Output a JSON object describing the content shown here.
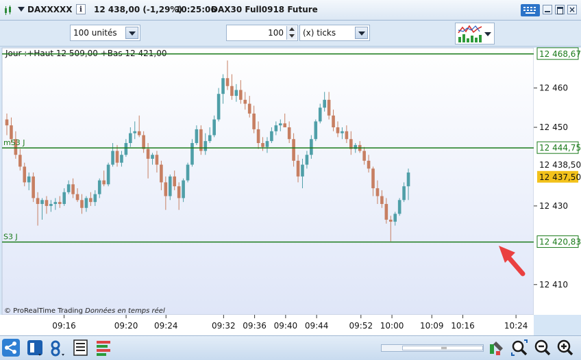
{
  "title_bar": {
    "instrument": "DAXXXXX",
    "info_label": "i",
    "price_change": "12 438,00 (-1,29%)",
    "time": "10:25:06",
    "contract": "DAX30 Full0918 Future"
  },
  "toolbar": {
    "units_value": "100 unités",
    "tick_count": "100",
    "period_type": "(x) ticks"
  },
  "chart_data": {
    "type": "candlestick",
    "title": "Jour :+Haut 12 509,00 +Bas 12 421,00",
    "ylim": [
      12402.3,
      12470.2
    ],
    "y_ticks": [
      12410,
      12430,
      12450,
      12460
    ],
    "y_tick_labels": [
      "12 410",
      "12 430",
      "12 450",
      "12 460"
    ],
    "x_tick_labels": [
      "09:16",
      "09:20",
      "09:24",
      "09:32",
      "09:36",
      "09:40",
      "09:44",
      "09:52",
      "10:00",
      "10:09",
      "10:16",
      "10:24"
    ],
    "levels": [
      {
        "name": "",
        "value": 12468.67,
        "label": "12 468,67",
        "color": "#1a7a1a"
      },
      {
        "name": "mS3 J",
        "value": 12444.75,
        "label": "12 444,75",
        "color": "#1a7a1a"
      },
      {
        "name": "S3 J",
        "value": 12420.83,
        "label": "12 420,83",
        "color": "#1a7a1a"
      }
    ],
    "last_price_label": "12 438,50",
    "current_price": {
      "value": 12437.5,
      "label": "12 437,50",
      "color": "#f3c21b"
    },
    "candles": [
      {
        "o": 12452.0,
        "h": 12453.5,
        "l": 12448.0,
        "c": 12450.5
      },
      {
        "o": 12450.5,
        "h": 12452.5,
        "l": 12446.0,
        "c": 12447.0
      },
      {
        "o": 12447.0,
        "h": 12449.0,
        "l": 12442.0,
        "c": 12443.0
      },
      {
        "o": 12443.0,
        "h": 12444.5,
        "l": 12439.0,
        "c": 12440.0
      },
      {
        "o": 12440.0,
        "h": 12441.0,
        "l": 12435.0,
        "c": 12436.0
      },
      {
        "o": 12436.0,
        "h": 12438.5,
        "l": 12434.0,
        "c": 12437.5
      },
      {
        "o": 12437.5,
        "h": 12438.5,
        "l": 12431.0,
        "c": 12432.0
      },
      {
        "o": 12432.0,
        "h": 12433.5,
        "l": 12425.0,
        "c": 12430.5
      },
      {
        "o": 12430.5,
        "h": 12432.0,
        "l": 12426.5,
        "c": 12431.5
      },
      {
        "o": 12431.5,
        "h": 12432.5,
        "l": 12428.0,
        "c": 12430.0
      },
      {
        "o": 12430.0,
        "h": 12431.5,
        "l": 12428.5,
        "c": 12430.5
      },
      {
        "o": 12430.5,
        "h": 12432.0,
        "l": 12429.0,
        "c": 12431.0
      },
      {
        "o": 12431.0,
        "h": 12432.5,
        "l": 12429.5,
        "c": 12430.5
      },
      {
        "o": 12430.5,
        "h": 12434.5,
        "l": 12430.0,
        "c": 12433.5
      },
      {
        "o": 12433.5,
        "h": 12436.5,
        "l": 12433.0,
        "c": 12435.5
      },
      {
        "o": 12435.5,
        "h": 12437.0,
        "l": 12432.0,
        "c": 12433.0
      },
      {
        "o": 12433.0,
        "h": 12434.5,
        "l": 12431.0,
        "c": 12431.5
      },
      {
        "o": 12431.5,
        "h": 12433.0,
        "l": 12428.0,
        "c": 12429.5
      },
      {
        "o": 12429.5,
        "h": 12432.5,
        "l": 12428.5,
        "c": 12432.0
      },
      {
        "o": 12432.0,
        "h": 12433.5,
        "l": 12430.0,
        "c": 12431.0
      },
      {
        "o": 12431.0,
        "h": 12434.0,
        "l": 12430.0,
        "c": 12433.0
      },
      {
        "o": 12433.0,
        "h": 12437.0,
        "l": 12432.0,
        "c": 12436.5
      },
      {
        "o": 12436.5,
        "h": 12439.0,
        "l": 12435.0,
        "c": 12435.5
      },
      {
        "o": 12435.5,
        "h": 12441.0,
        "l": 12435.0,
        "c": 12440.5
      },
      {
        "o": 12440.5,
        "h": 12446.0,
        "l": 12440.0,
        "c": 12444.0
      },
      {
        "o": 12444.0,
        "h": 12445.5,
        "l": 12440.0,
        "c": 12441.0
      },
      {
        "o": 12441.0,
        "h": 12444.0,
        "l": 12440.0,
        "c": 12443.0
      },
      {
        "o": 12443.0,
        "h": 12447.0,
        "l": 12442.5,
        "c": 12446.0
      },
      {
        "o": 12446.0,
        "h": 12450.0,
        "l": 12445.0,
        "c": 12448.5
      },
      {
        "o": 12448.5,
        "h": 12451.5,
        "l": 12447.0,
        "c": 12449.0
      },
      {
        "o": 12449.0,
        "h": 12453.0,
        "l": 12447.5,
        "c": 12448.0
      },
      {
        "o": 12448.0,
        "h": 12449.0,
        "l": 12443.5,
        "c": 12444.5
      },
      {
        "o": 12444.5,
        "h": 12446.0,
        "l": 12437.0,
        "c": 12442.0
      },
      {
        "o": 12442.0,
        "h": 12443.5,
        "l": 12440.5,
        "c": 12443.0
      },
      {
        "o": 12443.0,
        "h": 12444.0,
        "l": 12438.5,
        "c": 12440.5
      },
      {
        "o": 12440.5,
        "h": 12441.5,
        "l": 12434.0,
        "c": 12436.0
      },
      {
        "o": 12436.0,
        "h": 12437.5,
        "l": 12429.0,
        "c": 12432.5
      },
      {
        "o": 12432.5,
        "h": 12438.0,
        "l": 12431.5,
        "c": 12437.5
      },
      {
        "o": 12437.5,
        "h": 12439.0,
        "l": 12434.0,
        "c": 12435.0
      },
      {
        "o": 12435.0,
        "h": 12436.0,
        "l": 12429.0,
        "c": 12432.0
      },
      {
        "o": 12432.0,
        "h": 12437.0,
        "l": 12431.0,
        "c": 12436.5
      },
      {
        "o": 12436.5,
        "h": 12441.0,
        "l": 12436.0,
        "c": 12440.5
      },
      {
        "o": 12440.5,
        "h": 12447.0,
        "l": 12440.0,
        "c": 12446.0
      },
      {
        "o": 12446.0,
        "h": 12450.5,
        "l": 12445.5,
        "c": 12449.5
      },
      {
        "o": 12449.5,
        "h": 12450.5,
        "l": 12443.0,
        "c": 12444.0
      },
      {
        "o": 12444.0,
        "h": 12448.5,
        "l": 12443.0,
        "c": 12446.5
      },
      {
        "o": 12446.5,
        "h": 12450.0,
        "l": 12446.0,
        "c": 12448.0
      },
      {
        "o": 12448.0,
        "h": 12453.0,
        "l": 12447.5,
        "c": 12452.0
      },
      {
        "o": 12452.0,
        "h": 12460.0,
        "l": 12451.5,
        "c": 12458.5
      },
      {
        "o": 12458.5,
        "h": 12463.5,
        "l": 12456.0,
        "c": 12462.5
      },
      {
        "o": 12462.5,
        "h": 12467.0,
        "l": 12459.5,
        "c": 12460.5
      },
      {
        "o": 12460.5,
        "h": 12463.5,
        "l": 12457.0,
        "c": 12458.0
      },
      {
        "o": 12458.0,
        "h": 12461.0,
        "l": 12456.5,
        "c": 12459.5
      },
      {
        "o": 12459.5,
        "h": 12462.0,
        "l": 12456.0,
        "c": 12457.0
      },
      {
        "o": 12457.0,
        "h": 12459.0,
        "l": 12454.5,
        "c": 12456.0
      },
      {
        "o": 12456.0,
        "h": 12458.0,
        "l": 12452.5,
        "c": 12453.5
      },
      {
        "o": 12453.5,
        "h": 12455.5,
        "l": 12448.5,
        "c": 12449.5
      },
      {
        "o": 12449.5,
        "h": 12451.5,
        "l": 12444.5,
        "c": 12446.0
      },
      {
        "o": 12446.0,
        "h": 12447.5,
        "l": 12444.0,
        "c": 12445.0
      },
      {
        "o": 12445.0,
        "h": 12447.5,
        "l": 12443.5,
        "c": 12446.5
      },
      {
        "o": 12446.5,
        "h": 12450.0,
        "l": 12446.0,
        "c": 12449.0
      },
      {
        "o": 12449.0,
        "h": 12451.5,
        "l": 12448.0,
        "c": 12450.5
      },
      {
        "o": 12450.5,
        "h": 12452.0,
        "l": 12449.0,
        "c": 12451.0
      },
      {
        "o": 12451.0,
        "h": 12453.5,
        "l": 12450.0,
        "c": 12450.0
      },
      {
        "o": 12450.0,
        "h": 12451.5,
        "l": 12446.0,
        "c": 12447.0
      },
      {
        "o": 12447.0,
        "h": 12448.5,
        "l": 12440.0,
        "c": 12441.5
      },
      {
        "o": 12441.5,
        "h": 12443.0,
        "l": 12436.0,
        "c": 12437.5
      },
      {
        "o": 12437.5,
        "h": 12442.0,
        "l": 12434.5,
        "c": 12440.5
      },
      {
        "o": 12440.5,
        "h": 12444.0,
        "l": 12439.5,
        "c": 12443.0
      },
      {
        "o": 12443.0,
        "h": 12448.0,
        "l": 12442.0,
        "c": 12447.0
      },
      {
        "o": 12447.0,
        "h": 12452.0,
        "l": 12446.5,
        "c": 12451.5
      },
      {
        "o": 12451.5,
        "h": 12456.0,
        "l": 12451.0,
        "c": 12455.0
      },
      {
        "o": 12455.0,
        "h": 12459.0,
        "l": 12454.0,
        "c": 12457.0
      },
      {
        "o": 12457.0,
        "h": 12459.0,
        "l": 12452.0,
        "c": 12453.0
      },
      {
        "o": 12453.0,
        "h": 12454.5,
        "l": 12449.0,
        "c": 12450.0
      },
      {
        "o": 12450.0,
        "h": 12451.5,
        "l": 12447.5,
        "c": 12448.5
      },
      {
        "o": 12448.5,
        "h": 12450.0,
        "l": 12447.0,
        "c": 12449.0
      },
      {
        "o": 12449.0,
        "h": 12450.5,
        "l": 12446.0,
        "c": 12447.0
      },
      {
        "o": 12447.0,
        "h": 12449.0,
        "l": 12443.0,
        "c": 12444.5
      },
      {
        "o": 12444.5,
        "h": 12446.0,
        "l": 12443.5,
        "c": 12445.5
      },
      {
        "o": 12445.5,
        "h": 12446.5,
        "l": 12443.5,
        "c": 12444.0
      },
      {
        "o": 12444.0,
        "h": 12445.0,
        "l": 12440.5,
        "c": 12441.5
      },
      {
        "o": 12441.5,
        "h": 12443.0,
        "l": 12438.5,
        "c": 12439.5
      },
      {
        "o": 12439.5,
        "h": 12440.0,
        "l": 12432.5,
        "c": 12434.5
      },
      {
        "o": 12434.5,
        "h": 12436.5,
        "l": 12430.5,
        "c": 12432.5
      },
      {
        "o": 12432.5,
        "h": 12434.0,
        "l": 12429.5,
        "c": 12430.5
      },
      {
        "o": 12430.5,
        "h": 12432.0,
        "l": 12425.5,
        "c": 12426.5
      },
      {
        "o": 12426.5,
        "h": 12427.5,
        "l": 12421.0,
        "c": 12426.0
      },
      {
        "o": 12426.0,
        "h": 12428.5,
        "l": 12425.0,
        "c": 12428.0
      },
      {
        "o": 12428.0,
        "h": 12432.0,
        "l": 12427.5,
        "c": 12431.5
      },
      {
        "o": 12431.5,
        "h": 12436.0,
        "l": 12431.0,
        "c": 12435.0
      },
      {
        "o": 12435.0,
        "h": 12439.5,
        "l": 12431.5,
        "c": 12438.5
      }
    ]
  },
  "footer": {
    "brand": "© ProRealTime Trading",
    "realtime": "Données en temps réel"
  },
  "colors": {
    "bull": "#4f9fa8",
    "bear": "#c77f62",
    "level_line": "#1a7a1a",
    "chart_bg_top": "#ffffff",
    "chart_bg_bottom": "#dfe6f8",
    "arrow": "#ea4040"
  }
}
